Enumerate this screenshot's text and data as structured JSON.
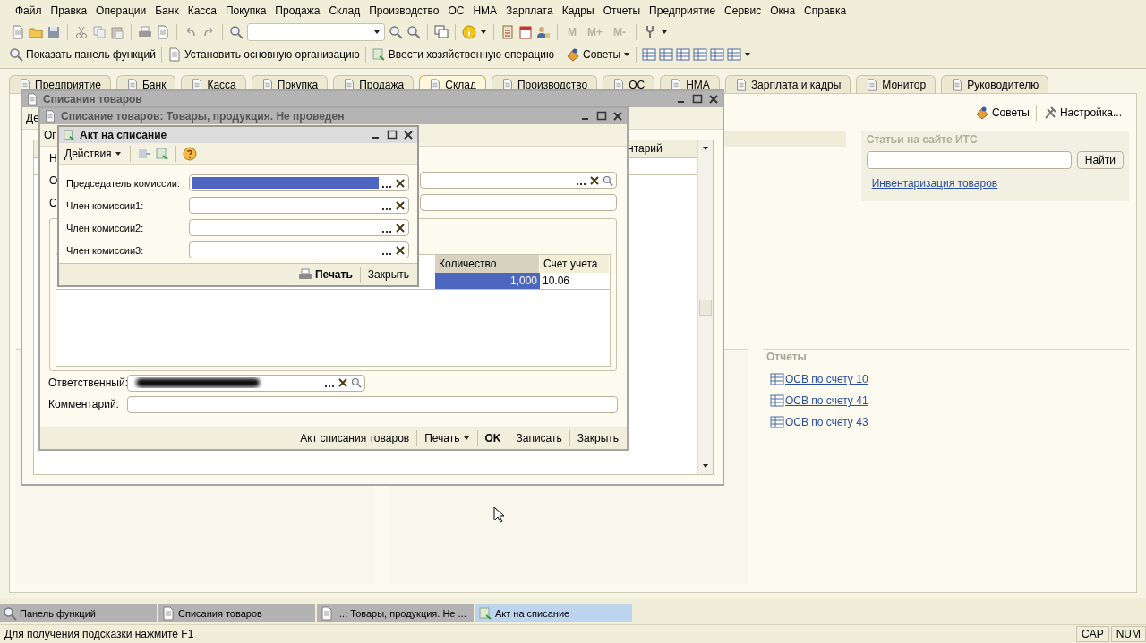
{
  "menu": [
    "Файл",
    "Правка",
    "Операции",
    "Банк",
    "Касса",
    "Покупка",
    "Продажа",
    "Склад",
    "Производство",
    "ОС",
    "НМА",
    "Зарплата",
    "Кадры",
    "Отчеты",
    "Предприятие",
    "Сервис",
    "Окна",
    "Справка"
  ],
  "memory_buttons": [
    {
      "label": "M",
      "disabled": true
    },
    {
      "label": "M+",
      "disabled": true
    },
    {
      "label": "M-",
      "disabled": true
    }
  ],
  "command_bar": [
    {
      "label": "Показать панель функций",
      "dropdown": false
    },
    {
      "label": "Установить основную организацию",
      "dropdown": false
    },
    {
      "label": "Ввести хозяйственную операцию",
      "dropdown": false
    },
    {
      "label": "Советы",
      "dropdown": true
    }
  ],
  "section_tabs": [
    {
      "label": "Предприятие",
      "selected": false
    },
    {
      "label": "Банк",
      "selected": false
    },
    {
      "label": "Касса",
      "selected": false
    },
    {
      "label": "Покупка",
      "selected": false
    },
    {
      "label": "Продажа",
      "selected": false
    },
    {
      "label": "Склад",
      "selected": true
    },
    {
      "label": "Производство",
      "selected": false
    },
    {
      "label": "ОС",
      "selected": false
    },
    {
      "label": "НМА",
      "selected": false
    },
    {
      "label": "Зарплата и кадры",
      "selected": false
    },
    {
      "label": "Монитор",
      "selected": false
    },
    {
      "label": "Руководителю",
      "selected": false
    }
  ],
  "function_panel": {
    "links": [
      "Советы",
      "Настройка..."
    ],
    "its": {
      "title": "Статьи на сайте ИТС",
      "button": "Найти",
      "links": [
        "Инвентаризация товаров"
      ]
    },
    "reports": {
      "title": "Отчеты",
      "links": [
        "ОСВ по счету 10",
        "ОСВ по счету 41",
        "ОСВ по счету 43"
      ]
    }
  },
  "list_window": {
    "title": "Списания товаров",
    "toolbar_fragment": "Де",
    "column_fragment": "нтарий"
  },
  "document_window": {
    "title": "Списание товаров: Товары, продукция. Не проведен",
    "toolbar_fragment": "Ог",
    "label_fragments": [
      "Н",
      "О",
      "С"
    ],
    "table": {
      "columns": [
        "Количество",
        "Счет учета"
      ],
      "rows": [
        {
          "cells": [
            {
              "text": "1,000",
              "selected": true
            },
            {
              "text": "10.06",
              "selected": false
            }
          ]
        }
      ]
    },
    "responsible_label": "Ответственный:",
    "comment_label": "Комментарий:",
    "buttons": [
      {
        "label": "Акт списания товаров",
        "dropdown": false,
        "default": false
      },
      {
        "label": "Печать",
        "dropdown": true,
        "default": false
      },
      {
        "label": "OK",
        "dropdown": false,
        "default": true
      },
      {
        "label": "Записать",
        "dropdown": false,
        "default": false
      },
      {
        "label": "Закрыть",
        "dropdown": false,
        "default": false
      }
    ]
  },
  "dialog": {
    "title": "Акт на списание",
    "actions": "Действия",
    "fields": [
      {
        "label": "Председатель комиссии:",
        "focused": true
      },
      {
        "label": "Член комиссии1:",
        "focused": false
      },
      {
        "label": "Член комиссии2:",
        "focused": false
      },
      {
        "label": "Член комиссии3:",
        "focused": false
      }
    ],
    "buttons": [
      {
        "label": "Печать",
        "kind": "print"
      },
      {
        "label": "Закрыть",
        "kind": "plain"
      }
    ]
  },
  "taskbar": [
    {
      "label": "Панель функций",
      "selected": false
    },
    {
      "label": "Списания товаров",
      "selected": false
    },
    {
      "label": "...: Товары, продукция. Не ...",
      "selected": false
    },
    {
      "label": "Акт на списание",
      "selected": true
    }
  ],
  "status_bar": {
    "hint": "Для получения подсказки нажмите F1",
    "indicators": [
      "CAP",
      "NUM"
    ]
  }
}
